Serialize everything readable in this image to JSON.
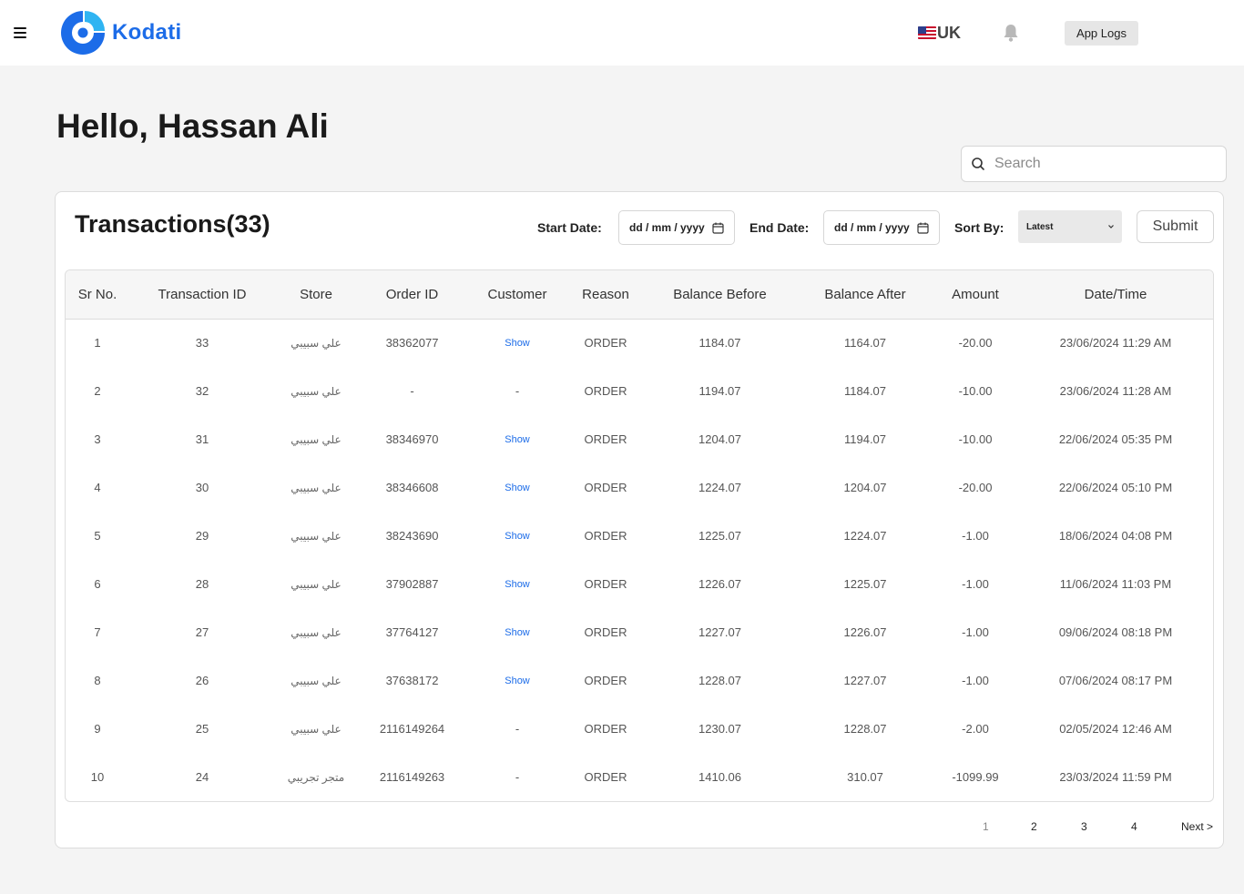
{
  "header": {
    "brand": "Kodati",
    "locale": "UK",
    "app_logs_label": "App Logs"
  },
  "colors": {
    "brand": "#1c6ce8",
    "link": "#1c6ce8"
  },
  "icons": {
    "menu": "hamburger-icon",
    "logo": "kodati-logo",
    "locale": "us-flag-icon",
    "notifications": "bell-icon",
    "search": "search-icon",
    "calendar": "calendar-icon",
    "select": "chevron-down-icon"
  },
  "greeting": "Hello, Hassan Ali",
  "search": {
    "placeholder": "Search"
  },
  "transactions": {
    "title": "Transactions(33)",
    "filters": {
      "start_label": "Start Date:",
      "start_value": "dd / mm / yyyy",
      "end_label": "End Date:",
      "end_value": "dd / mm / yyyy",
      "sort_label": "Sort By:",
      "sort_value": "Latest",
      "submit_label": "Submit"
    },
    "columns": [
      "Sr No.",
      "Transaction ID",
      "Store",
      "Order ID",
      "Customer",
      "Reason",
      "Balance Before",
      "Balance After",
      "Amount",
      "Date/Time"
    ],
    "rows": [
      [
        "1",
        "33",
        "علي سبيبي",
        "38362077",
        "Show",
        "ORDER",
        "1184.07",
        "1164.07",
        "-20.00",
        "23/06/2024 11:29 AM"
      ],
      [
        "2",
        "32",
        "علي سبيبي",
        "-",
        "-",
        "ORDER",
        "1194.07",
        "1184.07",
        "-10.00",
        "23/06/2024 11:28 AM"
      ],
      [
        "3",
        "31",
        "علي سبيبي",
        "38346970",
        "Show",
        "ORDER",
        "1204.07",
        "1194.07",
        "-10.00",
        "22/06/2024 05:35 PM"
      ],
      [
        "4",
        "30",
        "علي سبيبي",
        "38346608",
        "Show",
        "ORDER",
        "1224.07",
        "1204.07",
        "-20.00",
        "22/06/2024 05:10 PM"
      ],
      [
        "5",
        "29",
        "علي سبيبي",
        "38243690",
        "Show",
        "ORDER",
        "1225.07",
        "1224.07",
        "-1.00",
        "18/06/2024 04:08 PM"
      ],
      [
        "6",
        "28",
        "علي سبيبي",
        "37902887",
        "Show",
        "ORDER",
        "1226.07",
        "1225.07",
        "-1.00",
        "11/06/2024 11:03 PM"
      ],
      [
        "7",
        "27",
        "علي سبيبي",
        "37764127",
        "Show",
        "ORDER",
        "1227.07",
        "1226.07",
        "-1.00",
        "09/06/2024 08:18 PM"
      ],
      [
        "8",
        "26",
        "علي سبيبي",
        "37638172",
        "Show",
        "ORDER",
        "1228.07",
        "1227.07",
        "-1.00",
        "07/06/2024 08:17 PM"
      ],
      [
        "9",
        "25",
        "علي سبيبي",
        "2116149264",
        "-",
        "ORDER",
        "1230.07",
        "1228.07",
        "-2.00",
        "02/05/2024 12:46 AM"
      ],
      [
        "10",
        "24",
        "متجر تجريبي",
        "2116149263",
        "-",
        "ORDER",
        "1410.06",
        "310.07",
        "-1099.99",
        "23/03/2024 11:59 PM"
      ]
    ]
  },
  "pagination": {
    "pages": [
      "1",
      "2",
      "3",
      "4"
    ],
    "current": "1",
    "next_label": "Next >"
  }
}
